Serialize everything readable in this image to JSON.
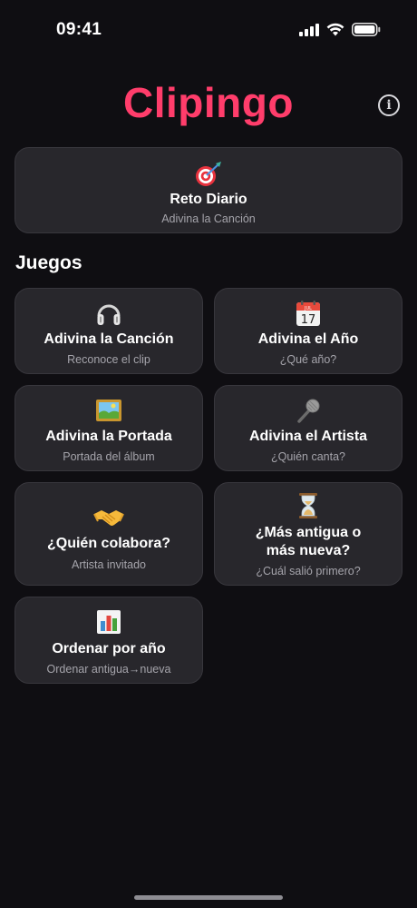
{
  "status": {
    "time": "09:41"
  },
  "app": {
    "title": "Clipingo",
    "accent": "#ff3d6b"
  },
  "daily": {
    "icon": "target-dart-icon",
    "title": "Reto Diario",
    "subtitle": "Adivina la Canción"
  },
  "games_heading": "Juegos",
  "games": [
    {
      "icon": "headphones-icon",
      "title": "Adivina la Canción",
      "subtitle": "Reconoce el clip"
    },
    {
      "icon": "calendar-icon",
      "title": "Adivina el Año",
      "subtitle": "¿Qué año?",
      "calendar_month": "JUL",
      "calendar_day": "17"
    },
    {
      "icon": "framed-picture-icon",
      "title": "Adivina la Portada",
      "subtitle": "Portada del álbum"
    },
    {
      "icon": "microphone-icon",
      "title": "Adivina el Artista",
      "subtitle": "¿Quién canta?"
    },
    {
      "icon": "handshake-icon",
      "title": "¿Quién colabora?",
      "subtitle": "Artista invitado"
    },
    {
      "icon": "hourglass-icon",
      "title_line1": "¿Más antigua o",
      "title_line2": "más nueva?",
      "subtitle": "¿Cuál salió primero?"
    },
    {
      "icon": "bar-chart-icon",
      "title": "Ordenar por año",
      "subtitle": "Ordenar antigua→nueva"
    }
  ]
}
